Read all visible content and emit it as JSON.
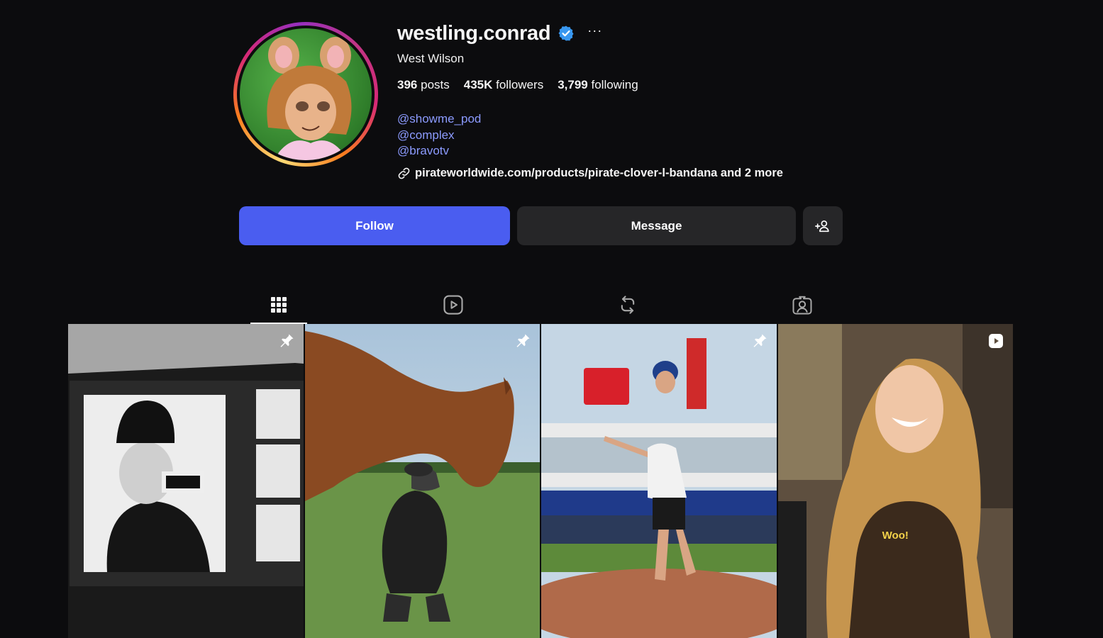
{
  "profile": {
    "username": "westling.conrad",
    "full_name": "West Wilson",
    "verified": true,
    "stats": {
      "posts_count": "396",
      "posts_label": "posts",
      "followers_count": "435K",
      "followers_label": "followers",
      "following_count": "3,799",
      "following_label": "following"
    },
    "mentions": [
      "@showme_pod",
      "@complex",
      "@bravotv"
    ],
    "link_text": "pirateworldwide.com/products/pirate-clover-l-bandana and 2 more"
  },
  "actions": {
    "follow_label": "Follow",
    "message_label": "Message"
  },
  "tabs": [
    {
      "name": "posts",
      "icon": "grid-icon",
      "active": true
    },
    {
      "name": "reels",
      "icon": "reels-icon",
      "active": false
    },
    {
      "name": "reposts",
      "icon": "repost-icon",
      "active": false
    },
    {
      "name": "tagged",
      "icon": "tagged-icon",
      "active": false
    }
  ],
  "posts": [
    {
      "badge": "pin-icon"
    },
    {
      "badge": "pin-icon"
    },
    {
      "badge": "pin-icon"
    },
    {
      "badge": "reel-icon",
      "caption": "Woo!"
    }
  ],
  "colors": {
    "background": "#0c0c0e",
    "follow_button": "#4a5df0",
    "secondary_button": "#262628",
    "mention_link": "#8c9bff",
    "verified_badge": "#3897f0"
  }
}
